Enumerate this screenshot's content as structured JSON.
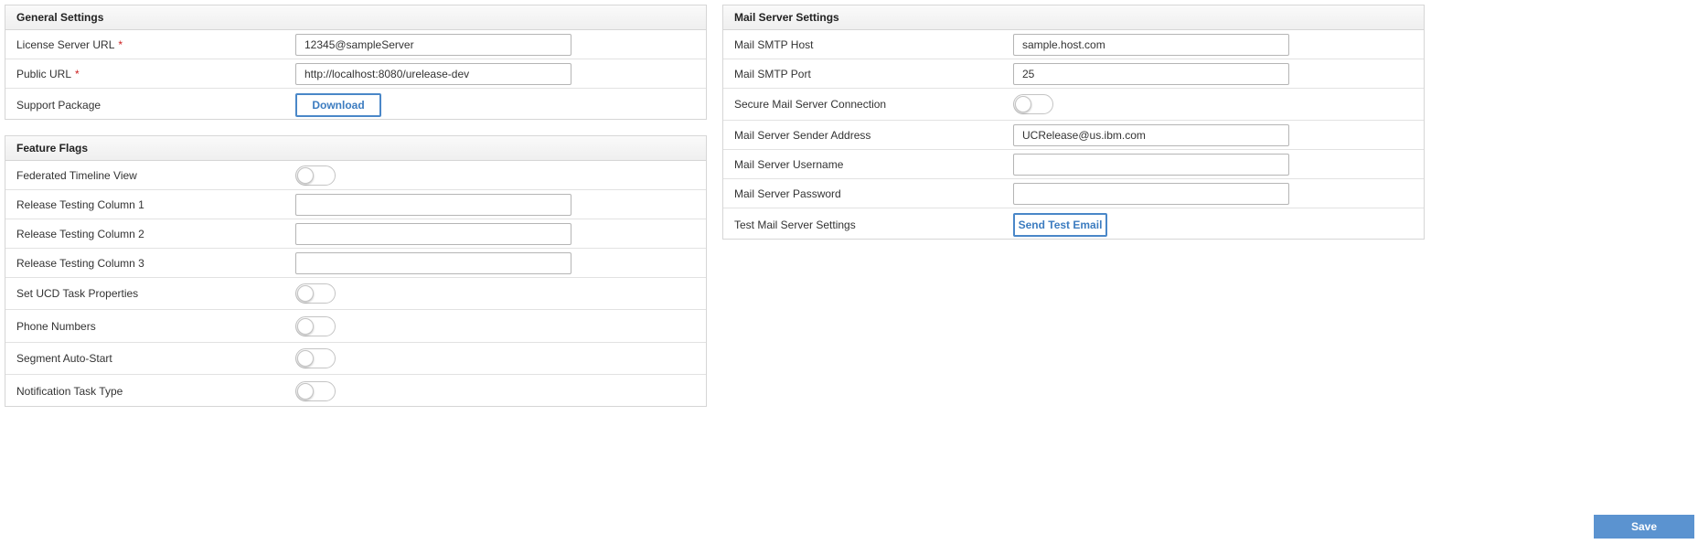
{
  "general_settings": {
    "title": "General Settings",
    "license_server_url": {
      "label": "License Server URL",
      "required": "*",
      "value": "12345@sampleServer"
    },
    "public_url": {
      "label": "Public URL",
      "required": "*",
      "value": "http://localhost:8080/urelease-dev"
    },
    "support_package": {
      "label": "Support Package",
      "button": "Download"
    }
  },
  "feature_flags": {
    "title": "Feature Flags",
    "federated_timeline_view": {
      "label": "Federated Timeline View",
      "enabled": false
    },
    "release_testing_column_1": {
      "label": "Release Testing Column 1",
      "value": ""
    },
    "release_testing_column_2": {
      "label": "Release Testing Column 2",
      "value": ""
    },
    "release_testing_column_3": {
      "label": "Release Testing Column 3",
      "value": ""
    },
    "set_ucd_task_properties": {
      "label": "Set UCD Task Properties",
      "enabled": false
    },
    "phone_numbers": {
      "label": "Phone Numbers",
      "enabled": false
    },
    "segment_auto_start": {
      "label": "Segment Auto-Start",
      "enabled": false
    },
    "notification_task_type": {
      "label": "Notification Task Type",
      "enabled": false
    }
  },
  "mail_server_settings": {
    "title": "Mail Server Settings",
    "smtp_host": {
      "label": "Mail SMTP Host",
      "value": "sample.host.com"
    },
    "smtp_port": {
      "label": "Mail SMTP Port",
      "value": "25"
    },
    "secure_connection": {
      "label": "Secure Mail Server Connection",
      "enabled": false
    },
    "sender_address": {
      "label": "Mail Server Sender Address",
      "value": "UCRelease@us.ibm.com"
    },
    "username": {
      "label": "Mail Server Username",
      "value": ""
    },
    "password": {
      "label": "Mail Server Password",
      "value": ""
    },
    "test_settings": {
      "label": "Test Mail Server Settings",
      "button": "Send Test Email"
    }
  },
  "footer": {
    "save_label": "Save"
  },
  "colors": {
    "accent": "#4a87c8",
    "save_button": "#5b93d0",
    "required": "#cc1f1f"
  }
}
